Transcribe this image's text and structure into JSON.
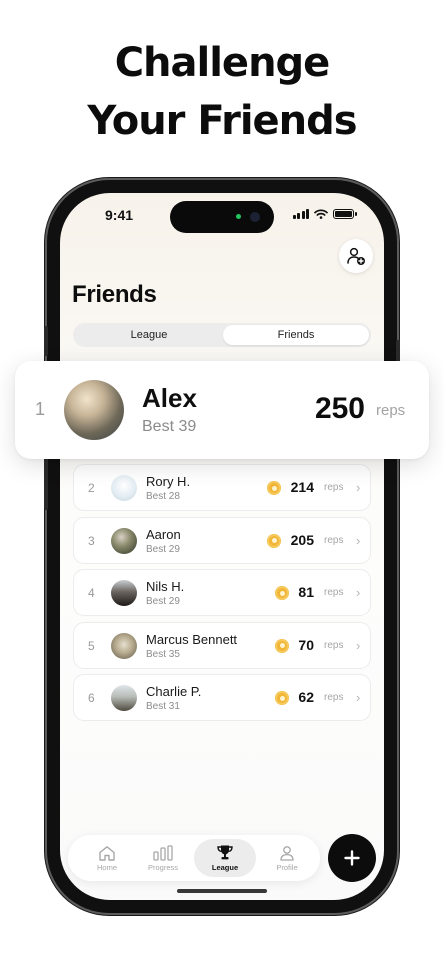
{
  "headline": {
    "line1": "Challenge",
    "line2": "Your Friends"
  },
  "status_bar": {
    "time": "9:41"
  },
  "screen": {
    "title": "Friends",
    "add_friend_icon": "person-add-icon",
    "segments": [
      {
        "label": "League"
      },
      {
        "label": "Friends"
      }
    ],
    "selected_segment": "Friends"
  },
  "leader": {
    "rank": "1",
    "name": "Alex",
    "best": "Best 39",
    "score": "250",
    "unit": "reps"
  },
  "rows": [
    {
      "rank": "2",
      "name": "Rory H.",
      "best": "Best 28",
      "score": "214",
      "unit": "reps"
    },
    {
      "rank": "3",
      "name": "Aaron",
      "best": "Best 29",
      "score": "205",
      "unit": "reps"
    },
    {
      "rank": "4",
      "name": "Nils H.",
      "best": "Best 29",
      "score": "81",
      "unit": "reps"
    },
    {
      "rank": "5",
      "name": "Marcus Bennett",
      "best": "Best 35",
      "score": "70",
      "unit": "reps"
    },
    {
      "rank": "6",
      "name": "Charlie P.",
      "best": "Best 31",
      "score": "62",
      "unit": "reps"
    }
  ],
  "nav": {
    "items": [
      {
        "label": "Home",
        "icon": "home-icon"
      },
      {
        "label": "Progress",
        "icon": "bar-chart-icon"
      },
      {
        "label": "League",
        "icon": "trophy-icon"
      },
      {
        "label": "Profile",
        "icon": "person-icon"
      }
    ],
    "active": "League",
    "fab_icon": "plus-icon"
  },
  "colors": {
    "coin": "#f2b637",
    "fab": "#0c0c0c",
    "accent": "#111111"
  }
}
